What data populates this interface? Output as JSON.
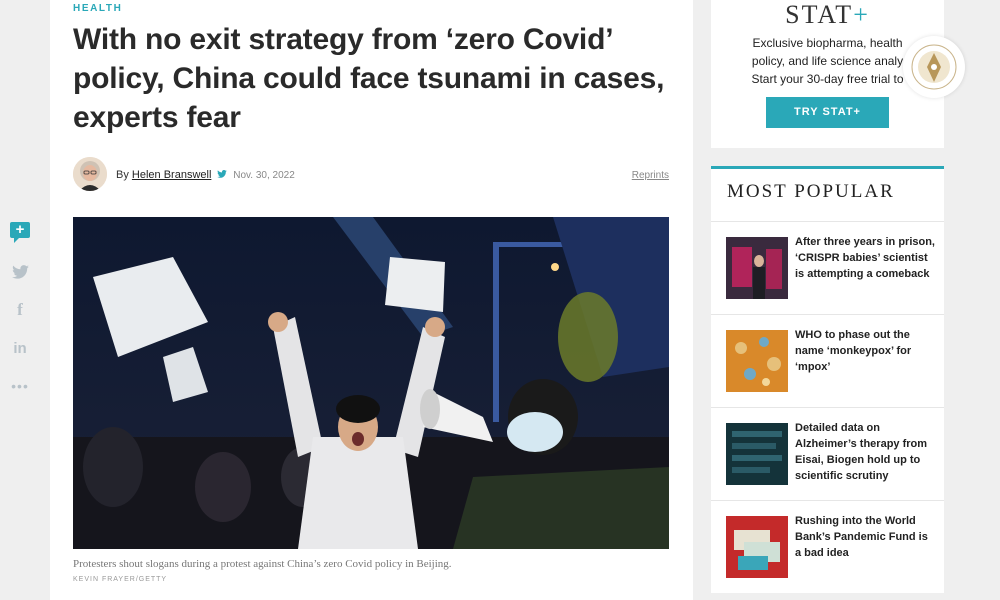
{
  "social": {
    "comment_icon": "comment-plus-icon",
    "twitter_icon": "twitter-icon",
    "facebook_icon": "facebook-icon",
    "linkedin_icon": "linkedin-icon",
    "more_icon": "more-icon",
    "facebook_glyph": "f",
    "linkedin_glyph": "in",
    "more_glyph": "•••",
    "comment_glyph": "+"
  },
  "article": {
    "kicker": "HEALTH",
    "headline": "With no exit strategy from ‘zero Covid’ policy, China could face tsunami in cases, experts fear",
    "byline_prefix": "By",
    "author": "Helen Branswell",
    "date": "Nov. 30, 2022",
    "reprints": "Reprints",
    "caption": "Protesters shout slogans during a protest against China’s zero Covid policy in Beijing.",
    "credit": "KEVIN FRAYER/GETTY"
  },
  "promo": {
    "logo": "STAT",
    "logo_plus": "+",
    "text_line1": "Exclusive biopharma, health",
    "text_line2": "policy, and life science analy",
    "text_line3": "Start your 30-day free trial to",
    "button": "TRY STAT+"
  },
  "popular": {
    "title": "MOST POPULAR",
    "items": [
      {
        "headline": "After three years in prison, ‘CRISPR babies’ scientist is attempting a comeback"
      },
      {
        "headline": "WHO to phase out the name ‘monkeypox’ for ‘mpox’"
      },
      {
        "headline": "Detailed data on Alzheimer’s therapy from Eisai, Biogen hold up to scientific scrutiny"
      },
      {
        "headline": "Rushing into the World Bank’s Pandemic Fund is a bad idea"
      }
    ]
  },
  "colors": {
    "accent": "#2aa8b8",
    "background": "#efefef",
    "text": "#2a2a2a"
  }
}
